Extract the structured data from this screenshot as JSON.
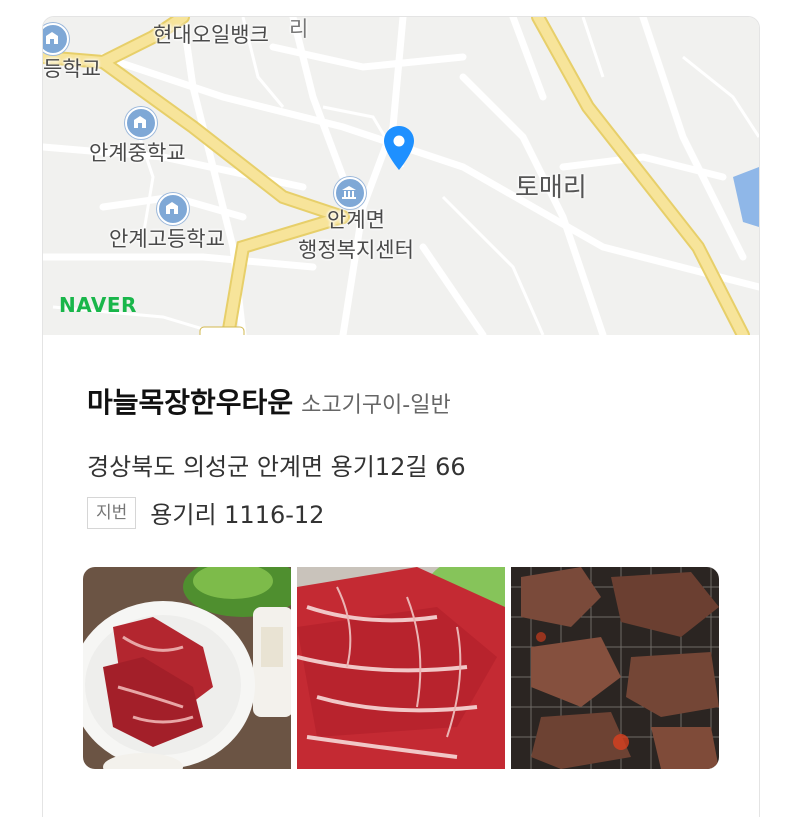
{
  "map": {
    "labels": {
      "bank": "현대오일뱅크",
      "school_cut": "등학교",
      "middle_school": "안계중학교",
      "high_school": "안계고등학교",
      "office_line1": "안계면",
      "office_line2": "행정복지센터",
      "village": "토매리",
      "road_cut": "리"
    },
    "brand": "NAVER",
    "icons": [
      "school-icon",
      "government-building-icon",
      "location-pin-icon"
    ],
    "colors": {
      "road_major": "#f4dc7e",
      "water": "#8fb7e8",
      "brand": "#19b64a",
      "pin": "#1e90ff"
    }
  },
  "place": {
    "name": "마늘목장한우타운",
    "category": "소고기구이-일반",
    "address": "경상북도 의성군 안계면 용기12길 66",
    "jibun_badge": "지번",
    "jibun_address": "용기리 1116-12"
  },
  "photos": [
    "raw-beef-plate-photo",
    "marbled-beef-photo",
    "grilled-beef-photo"
  ]
}
